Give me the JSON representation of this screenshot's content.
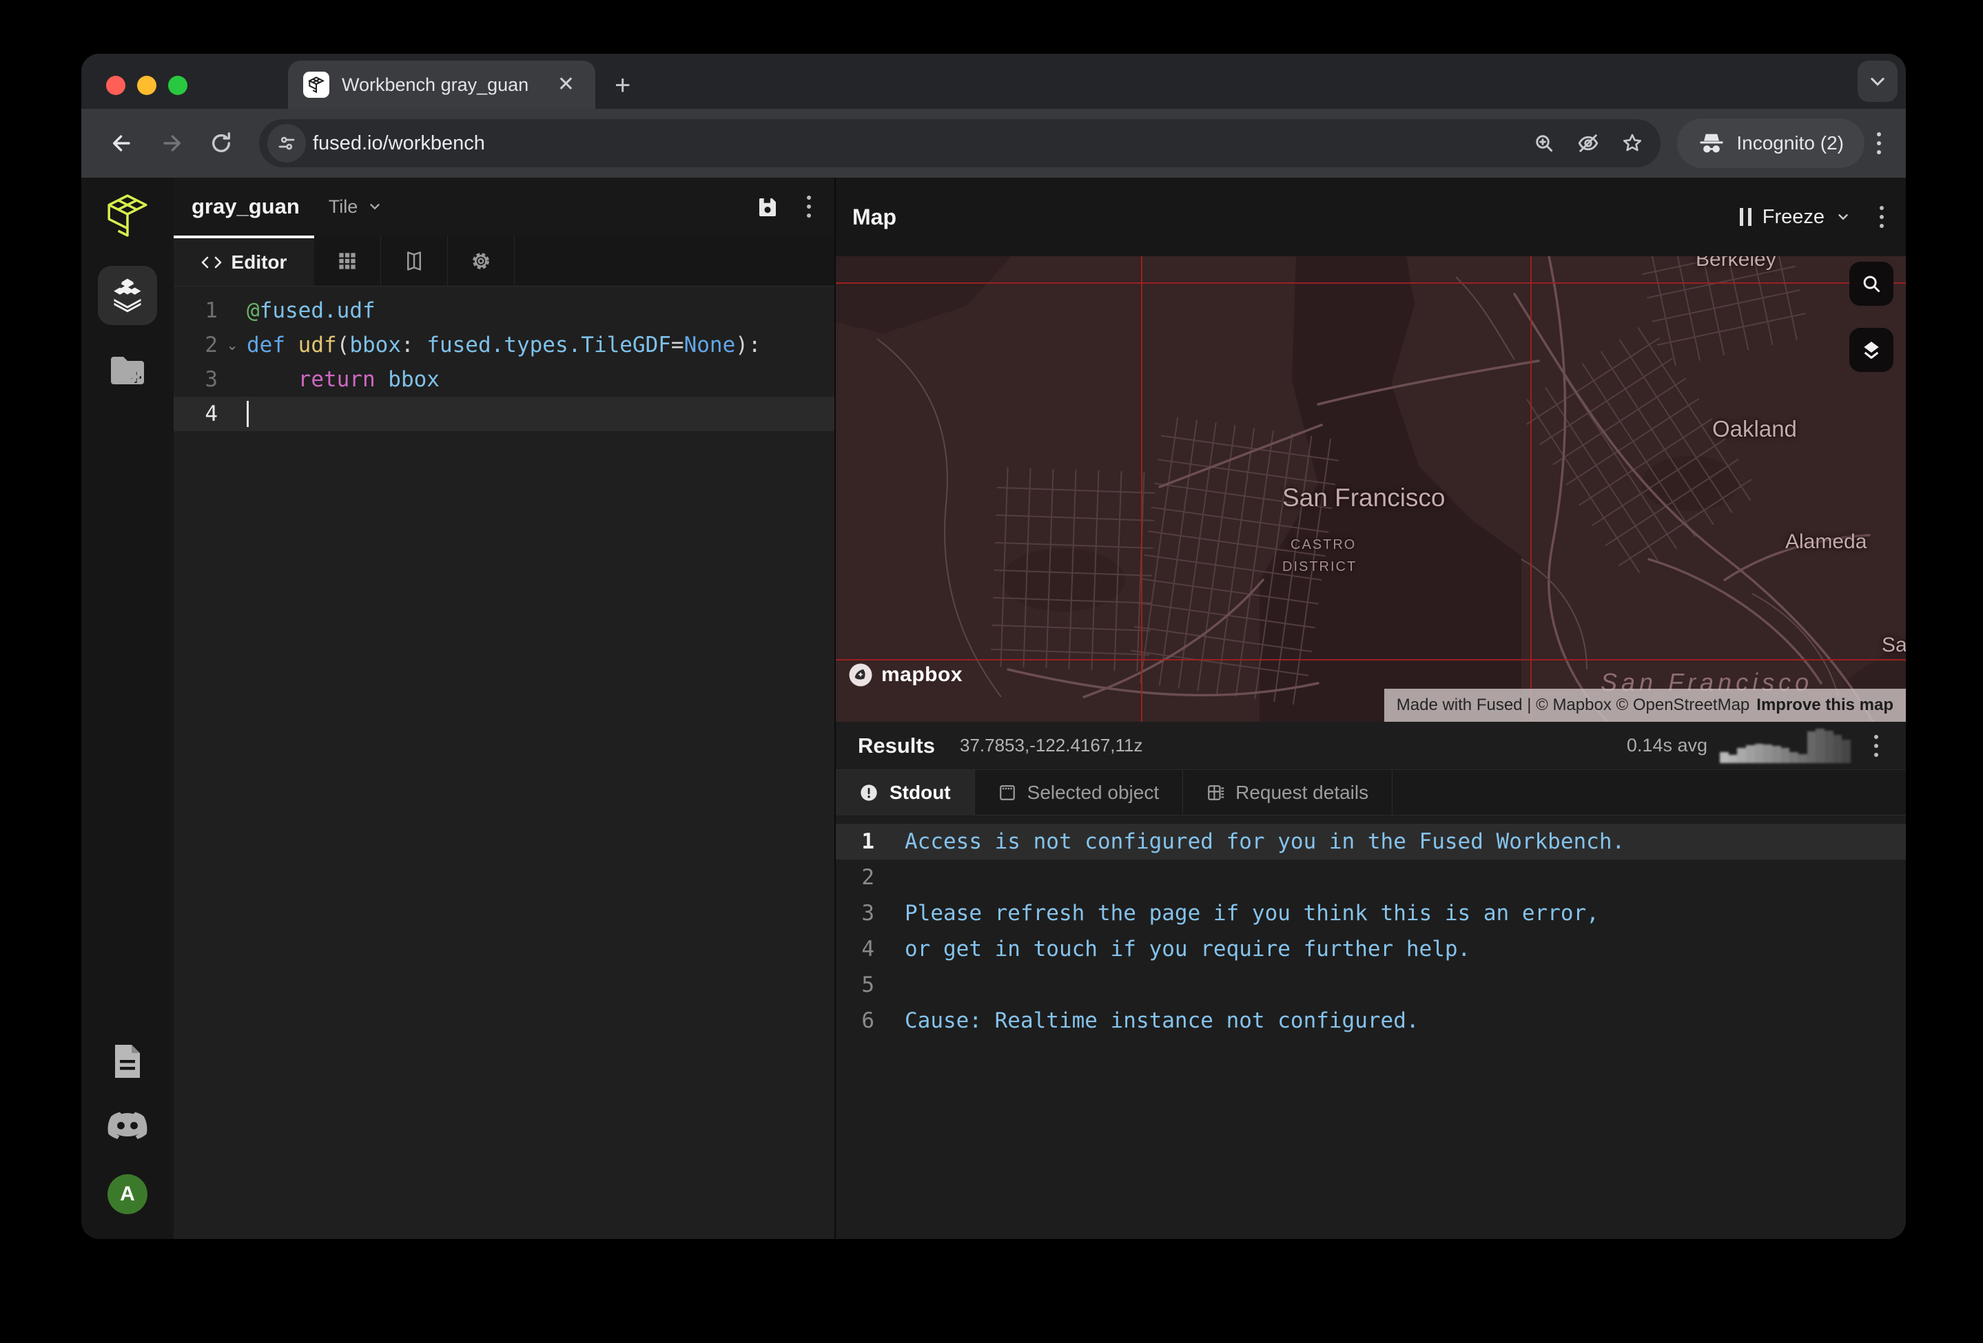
{
  "browser": {
    "tab_title": "Workbench gray_guan",
    "url": "fused.io/workbench",
    "incognito_label": "Incognito (2)"
  },
  "sidebar": {
    "avatar_letter": "A"
  },
  "editor": {
    "project_name": "gray_guan",
    "mode_label": "Tile",
    "tab_label": "Editor",
    "token_colors": {
      "green": "#69b36a",
      "blue": "#61a7e8",
      "blue_light": "#7fc1ea",
      "yellow": "#e2c572",
      "magenta": "#cf68c1",
      "punct": "#d4d4d4"
    },
    "code_lines": [
      {
        "num": "1",
        "tokens": [
          {
            "t": "@",
            "c": "green"
          },
          {
            "t": "fused.udf",
            "c": "blue_light"
          }
        ]
      },
      {
        "num": "2",
        "fold": true,
        "tokens": [
          {
            "t": "def ",
            "c": "blue"
          },
          {
            "t": "udf",
            "c": "yellow"
          },
          {
            "t": "(",
            "c": "punct"
          },
          {
            "t": "bbox",
            "c": "blue_light"
          },
          {
            "t": ": ",
            "c": "punct"
          },
          {
            "t": "fused.types.TileGDF",
            "c": "blue_light"
          },
          {
            "t": "=",
            "c": "punct"
          },
          {
            "t": "None",
            "c": "blue"
          },
          {
            "t": "):",
            "c": "punct"
          }
        ]
      },
      {
        "num": "3",
        "tokens": [
          {
            "t": "    ",
            "c": "punct"
          },
          {
            "t": "return",
            "c": "magenta"
          },
          {
            "t": " bbox",
            "c": "blue_light"
          }
        ]
      },
      {
        "num": "4",
        "active": true,
        "cursor": true,
        "tokens": []
      }
    ]
  },
  "map": {
    "title": "Map",
    "freeze_label": "Freeze",
    "labels": {
      "berkeley": "Berkeley",
      "oakland": "Oakland",
      "alameda": "Alameda",
      "san_francisco": "San Francisco",
      "castro_line1": "CASTRO",
      "castro_line2": "DISTRICT",
      "edge_partial": "Sa",
      "water": "San Francisco"
    },
    "logo_text": "mapbox",
    "attribution_prefix": "Made with Fused | © Mapbox © OpenStreetMap",
    "attribution_link": "Improve this map"
  },
  "results": {
    "title": "Results",
    "coords": "37.7853,-122.4167,11z",
    "avg_label": "0.14s avg",
    "tabs": [
      {
        "id": "stdout",
        "label": "Stdout",
        "active": true
      },
      {
        "id": "selected-object",
        "label": "Selected object",
        "active": false
      },
      {
        "id": "request-details",
        "label": "Request details",
        "active": false
      }
    ],
    "stdout_lines": [
      {
        "num": "1",
        "text": "Access is not configured for you in the Fused Workbench.",
        "highlight": true
      },
      {
        "num": "2",
        "text": ""
      },
      {
        "num": "3",
        "text": "Please refresh the page if you think this is an error,"
      },
      {
        "num": "4",
        "text": "or get in touch if you require further help."
      },
      {
        "num": "5",
        "text": ""
      },
      {
        "num": "6",
        "text": "Cause: Realtime instance not configured."
      }
    ],
    "sparkline": [
      16,
      12,
      22,
      26,
      28,
      27,
      25,
      22,
      16,
      13,
      46,
      50,
      47,
      41,
      34
    ]
  },
  "colors": {
    "accent_lime": "#d9ee4e",
    "avatar_green": "#3c7a2b",
    "tile_grid_red": "#9e2222",
    "stdout_text": "#85c3ec"
  }
}
